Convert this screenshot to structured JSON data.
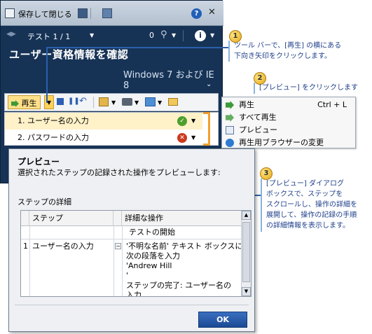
{
  "runner": {
    "save_close": "保存して閉じる",
    "test_position": "テスト 1 / 1",
    "attachment_count": "0",
    "title": "ユーザー資格情報を確認",
    "environment": "Windows 7 および IE 8",
    "play_label": "再生",
    "steps": [
      {
        "label": "1. ユーザー名の入力",
        "status": "pass"
      },
      {
        "label": "2. パスワードの入力",
        "status": "fail"
      }
    ]
  },
  "menu": {
    "items": [
      {
        "label": "再生",
        "shortcut": "Ctrl + L",
        "icon": "play-icon"
      },
      {
        "label": "すべて再生",
        "shortcut": "",
        "icon": "play-all-icon"
      },
      {
        "label": "プレビュー",
        "shortcut": "",
        "icon": "preview-icon"
      },
      {
        "label": "再生用ブラウザーの変更",
        "shortcut": "",
        "icon": "browser-icon"
      }
    ]
  },
  "callouts": [
    {
      "number": "1",
      "text_lines": [
        "ツール バーで、[再生] の横にある",
        "下向き矢印をクリックします。"
      ]
    },
    {
      "number": "2",
      "text_lines": [
        "[プレビュー] をクリックします"
      ]
    },
    {
      "number": "3",
      "text_lines": [
        "[プレビュー] ダイアログ",
        "ボックスで、ステップを",
        "スクロールし、操作の詳細を",
        "展開して、操作の記録の手順",
        "の詳細情報を表示します。"
      ]
    }
  ],
  "dialog": {
    "title": "プレビュー",
    "description": "選択されたステップの記録された操作をプレビューします:",
    "section": "ステップの詳細",
    "columns": [
      "ステップ",
      "詳細な操作"
    ],
    "rows": [
      {
        "index": "",
        "step": "",
        "details": [
          "テストの開始"
        ]
      },
      {
        "index": "1",
        "step": "ユーザー名の入力",
        "details": [
          "'不明な名前' テキスト ボックスに",
          "次の段落を入力",
          "'Andrew Hill",
          "'",
          "ステップの完了: ユーザー名の",
          "入力"
        ]
      }
    ],
    "ok_label": "OK"
  },
  "colors": {
    "runner_bg": "#163356",
    "callout_text": "#1e3f8a",
    "ok_button": "#2a5daa"
  }
}
